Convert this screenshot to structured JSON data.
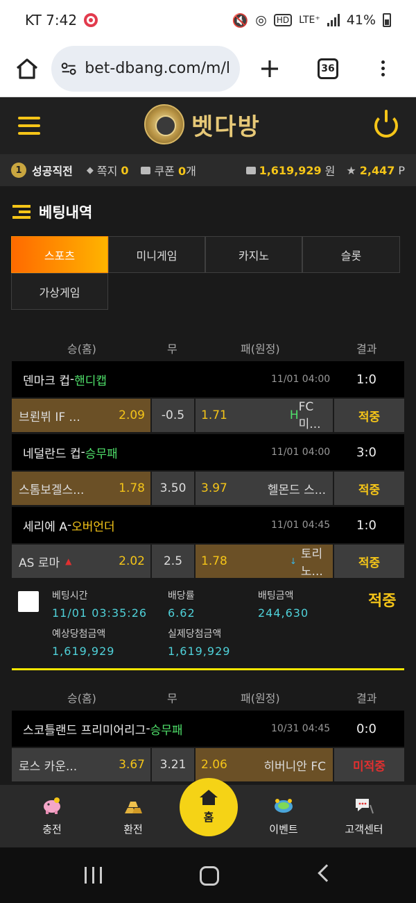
{
  "status": {
    "carrier_time": "KT 7:42",
    "net": "LTE⁺",
    "battery": "41%"
  },
  "browser": {
    "url": "bet-dbang.com/m/l",
    "tab_count": "36"
  },
  "site": {
    "logo_text": "벳다방"
  },
  "user": {
    "level": "1",
    "name": "성공직전",
    "note_label": "쪽지",
    "note_count": "0",
    "coupon_label": "쿠폰",
    "coupon_count": "0",
    "coupon_unit": "개",
    "balance": "1,619,929",
    "balance_unit": "원",
    "points": "2,447",
    "points_unit": "P"
  },
  "page": {
    "title": "베팅내역"
  },
  "tabs": [
    "스포츠",
    "미니게임",
    "카지노",
    "슬롯",
    "가상게임"
  ],
  "columns": {
    "home": "승(홈)",
    "draw": "무",
    "away": "패(원정)",
    "result": "결과"
  },
  "bet1": {
    "matches": [
      {
        "league": "덴마크 컵",
        "sep": " - ",
        "type": "핸디캡",
        "time": "11/01 04:00",
        "score": "1:0",
        "home": "브뢴뷔 IF ...",
        "home_odd": "2.09",
        "draw": "-0.5",
        "away_odd": "1.71",
        "away_mark": "H",
        "away": "FC 미...",
        "result": "적중"
      },
      {
        "league": "네덜란드 컵",
        "sep": " - ",
        "type": "승무패",
        "time": "11/01 04:00",
        "score": "3:0",
        "home": "스톰보겔스...",
        "home_odd": "1.78",
        "draw": "3.50",
        "away_odd": "3.97",
        "away_mark": "",
        "away": "헬몬드 스...",
        "result": "적중"
      },
      {
        "league": "세리에 A",
        "sep": " - ",
        "type": "오버언더",
        "time": "11/01 04:45",
        "score": "1:0",
        "home": "AS 로마",
        "home_mark": "▲",
        "home_odd": "2.02",
        "draw": "2.5",
        "away_odd": "1.78",
        "away_mark": "↓",
        "away": "토리노...",
        "result": "적중"
      }
    ],
    "summary": {
      "bet_time_label": "베팅시간",
      "bet_time": "11/01 03:35:26",
      "odds_label": "배당률",
      "odds": "6.62",
      "amount_label": "배팅금액",
      "amount": "244,630",
      "expected_label": "예상당첨금액",
      "expected": "1,619,929",
      "actual_label": "실제당첨금액",
      "actual": "1,619,929",
      "status": "적중"
    }
  },
  "bet2": {
    "matches": [
      {
        "league": "스코틀랜드 프리미어리그",
        "sep": " - ",
        "type": "승무패",
        "time": "10/31 04:45",
        "score": "0:0",
        "home": "로스 카운...",
        "home_odd": "3.67",
        "draw": "3.21",
        "away_odd": "2.06",
        "away": "히버니안 FC",
        "result": "미적중"
      }
    ]
  },
  "bottom_nav": {
    "deposit": "충전",
    "withdraw": "환전",
    "home": "홈",
    "event": "이벤트",
    "support": "고객센터"
  },
  "colors": {
    "accent": "#f5c518",
    "win_type": "#4fe06a",
    "value": "#4fd1d9",
    "tab_active": "#ff8a00"
  }
}
